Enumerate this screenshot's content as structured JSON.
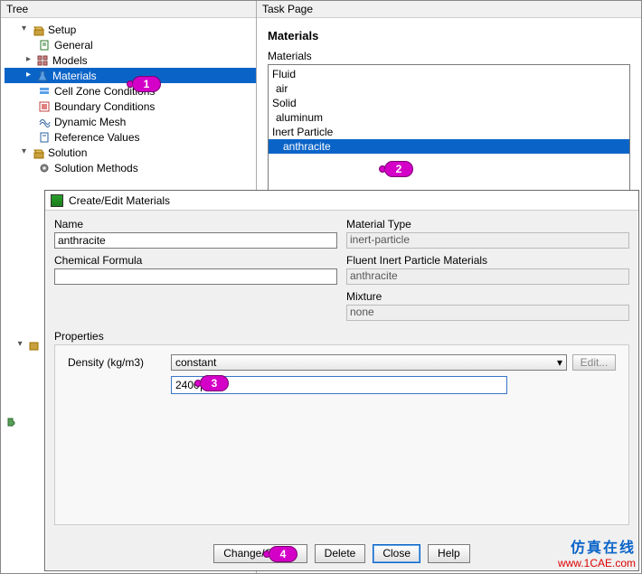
{
  "tree": {
    "header": "Tree",
    "setup": {
      "label": "Setup",
      "general": "General",
      "models": "Models",
      "materials": "Materials",
      "cell_zone": "Cell Zone Conditions",
      "boundary": "Boundary Conditions",
      "dynamic_mesh": "Dynamic Mesh",
      "reference": "Reference Values"
    },
    "solution": {
      "label": "Solution",
      "methods": "Solution Methods"
    }
  },
  "task": {
    "header": "Task Page",
    "title": "Materials",
    "listlabel": "Materials",
    "groups": {
      "fluid": "Fluid",
      "fluid_items": [
        "air"
      ],
      "solid": "Solid",
      "solid_items": [
        "aluminum"
      ],
      "inert": "Inert Particle",
      "inert_items": [
        "anthracite"
      ]
    }
  },
  "dialog": {
    "title": "Create/Edit Materials",
    "name_label": "Name",
    "name_value": "anthracite",
    "formula_label": "Chemical Formula",
    "formula_value": "",
    "type_label": "Material Type",
    "type_value": "inert-particle",
    "fluent_label": "Fluent Inert Particle Materials",
    "fluent_value": "anthracite",
    "mixture_label": "Mixture",
    "mixture_value": "none",
    "props_label": "Properties",
    "density_label": "Density (kg/m3)",
    "density_combo": "constant",
    "edit_btn": "Edit...",
    "density_value": "2400",
    "buttons": {
      "change": "Change/Create",
      "delete": "Delete",
      "close": "Close",
      "help": "Help"
    }
  },
  "callouts": {
    "c1": "1",
    "c2": "2",
    "c3": "3",
    "c4": "4"
  },
  "watermark": {
    "cn": "仿真在线",
    "url": "www.1CAE.com"
  }
}
